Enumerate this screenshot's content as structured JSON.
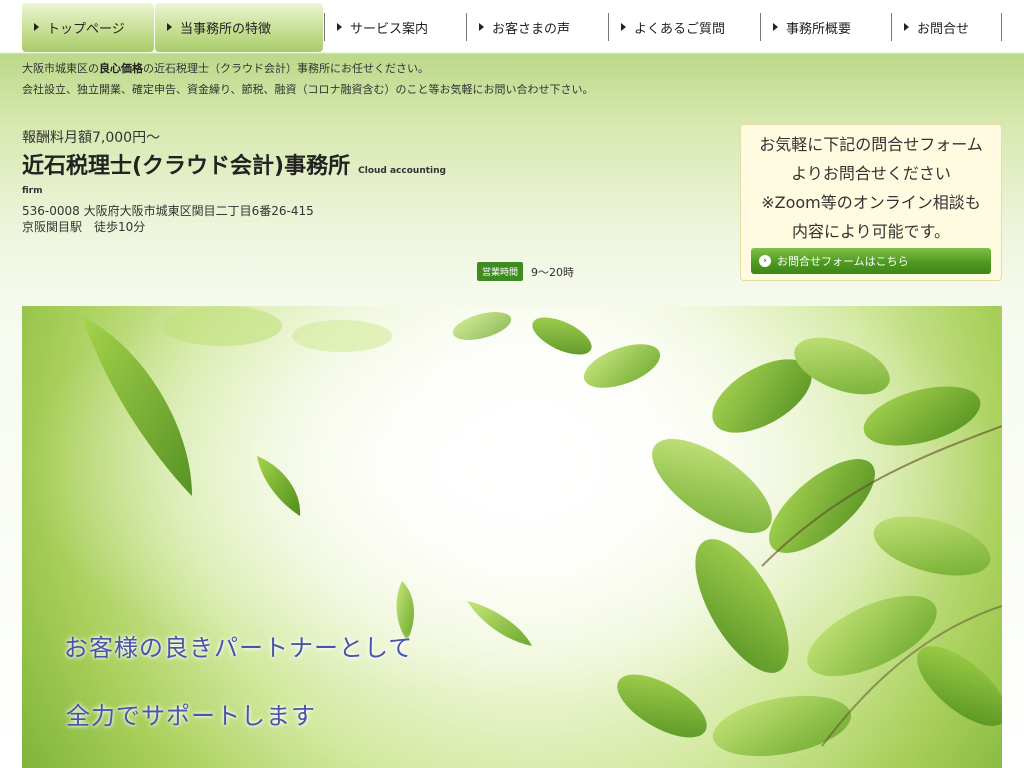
{
  "nav": [
    {
      "label": "トップページ"
    },
    {
      "label": "当事務所の特徴"
    },
    {
      "label": "サービス案内"
    },
    {
      "label": "お客さまの声"
    },
    {
      "label": "よくあるご質問"
    },
    {
      "label": "事務所概要"
    },
    {
      "label": "お問合せ"
    }
  ],
  "tagline": {
    "line1_pre": "大阪市城東区の",
    "line1_bold": "良心価格",
    "line1_post": "の近石税理士（クラウド会計）事務所にお任せください。",
    "line2": "会社設立、独立開業、確定申告、資金繰り、節税、融資（コロナ融資含む）のこと等お気軽にお問い合わせ下さい。"
  },
  "header": {
    "price": "報酬料月額7,000円～",
    "title": "近石税理士(クラウド会計)事務所",
    "title_en": "Cloud accounting",
    "firm": "firm",
    "address_line1": "536-0008 大阪府大阪市城東区関目二丁目6番26-415",
    "address_line2": "京阪関目駅　徒歩10分",
    "hours_label": "営業時間",
    "hours_value": "9～20時"
  },
  "contact": {
    "line1": "お気軽に下記の問合せフォーム",
    "line2": "よりお問合せください",
    "line3": "※Zoom等のオンライン相談も",
    "line4": "内容により可能です。",
    "button": "お問合せフォームはこちら"
  },
  "hero": {
    "line1": "お客様の良きパートナーとして",
    "line2": "全力でサポートします"
  },
  "colors": {
    "accent_green": "#3f8a22",
    "hero_text": "#4a55a8"
  }
}
